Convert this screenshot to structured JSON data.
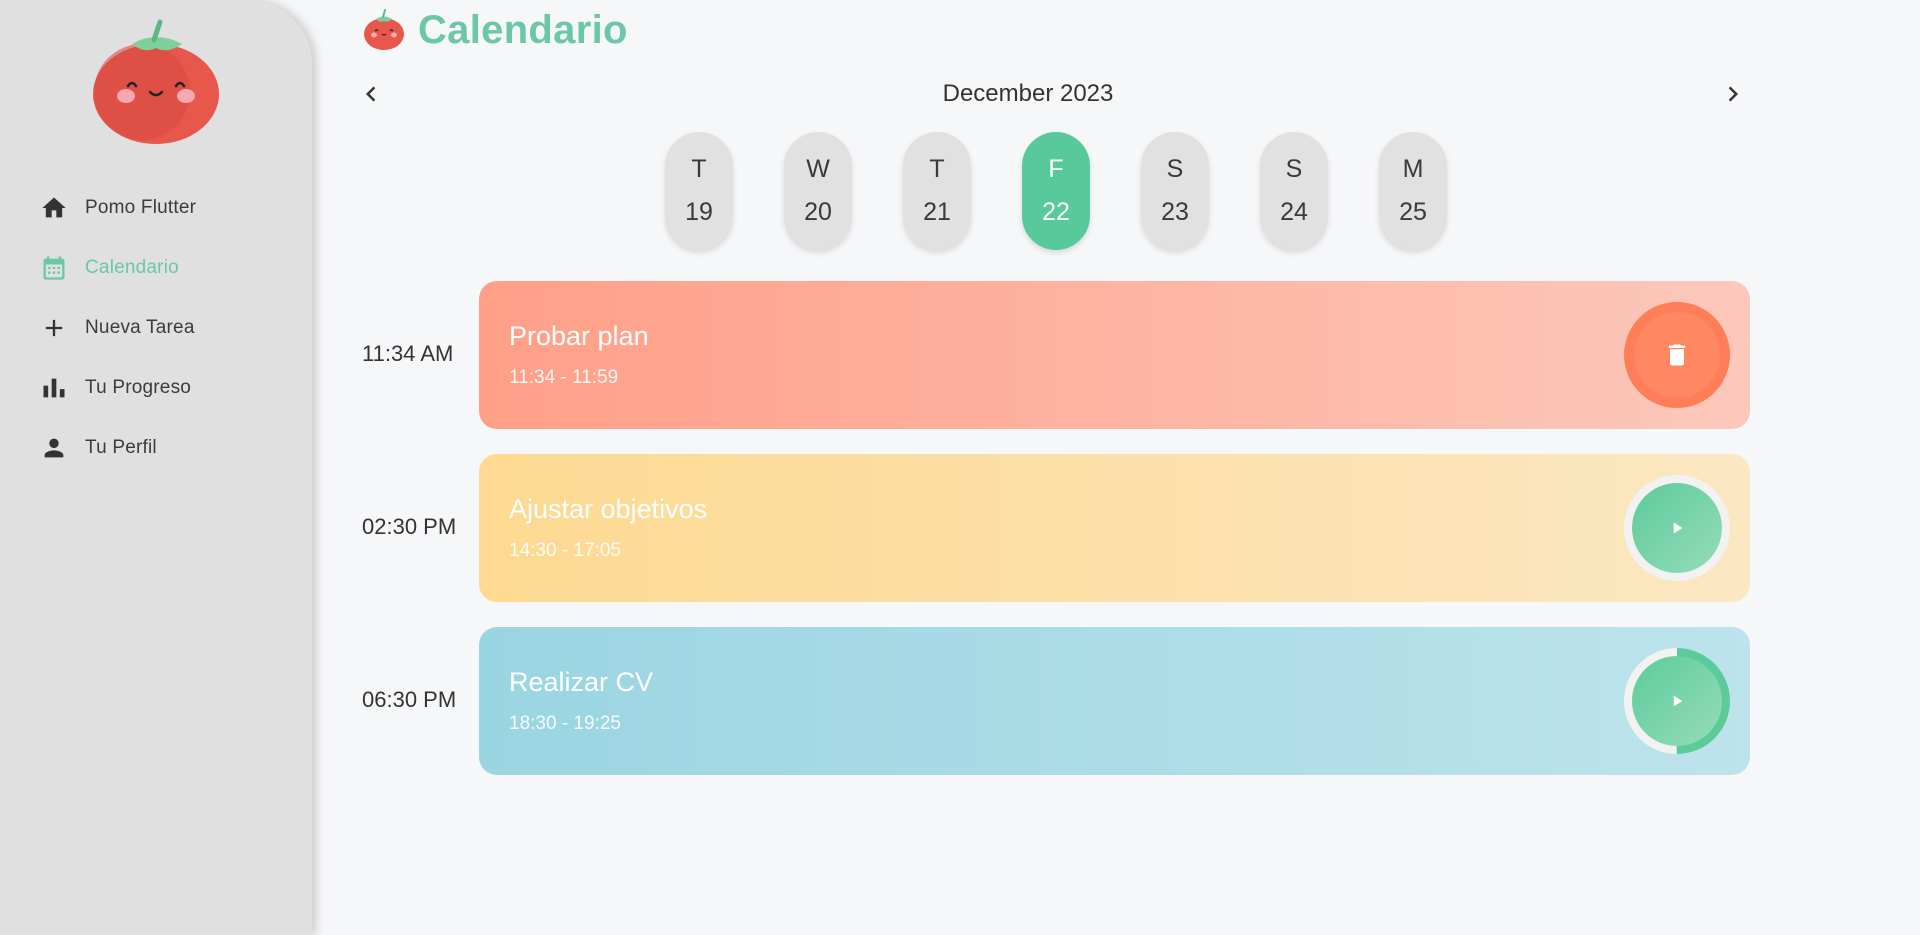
{
  "app": {
    "page_title": "Calendario",
    "accent_color": "#6cc7a4",
    "header_icon": "tomato-icon",
    "logo": "tomato-mascot-logo"
  },
  "sidebar": {
    "items": [
      {
        "label": "Pomo Flutter",
        "icon": "home-icon",
        "active": false
      },
      {
        "label": "Calendario",
        "icon": "calendar-icon",
        "active": true
      },
      {
        "label": "Nueva Tarea",
        "icon": "plus-icon",
        "active": false
      },
      {
        "label": "Tu Progreso",
        "icon": "bar-chart-icon",
        "active": false
      },
      {
        "label": "Tu Perfil",
        "icon": "person-icon",
        "active": false
      }
    ]
  },
  "calendar": {
    "month_label": "December 2023",
    "prev_icon": "chevron-left-icon",
    "next_icon": "chevron-right-icon",
    "days": [
      {
        "dow": "T",
        "num": "19",
        "selected": false
      },
      {
        "dow": "W",
        "num": "20",
        "selected": false
      },
      {
        "dow": "T",
        "num": "21",
        "selected": false
      },
      {
        "dow": "F",
        "num": "22",
        "selected": true
      },
      {
        "dow": "S",
        "num": "23",
        "selected": false
      },
      {
        "dow": "S",
        "num": "24",
        "selected": false
      },
      {
        "dow": "M",
        "num": "25",
        "selected": false
      }
    ],
    "selected_color": "#58c99b"
  },
  "tasks": [
    {
      "time": "11:34 AM",
      "name": "Probar plan",
      "range": "11:34 - 11:59",
      "color": "red",
      "action": "delete",
      "action_icon": "trash-icon",
      "progress": 0
    },
    {
      "time": "02:30 PM",
      "name": "Ajustar objetivos",
      "range": "14:30 - 17:05",
      "color": "yellow",
      "action": "play",
      "action_icon": "play-icon",
      "progress": 0
    },
    {
      "time": "06:30 PM",
      "name": "Realizar CV",
      "range": "18:30 - 19:25",
      "color": "blue",
      "action": "play",
      "action_icon": "play-icon",
      "progress": 0.5
    }
  ]
}
